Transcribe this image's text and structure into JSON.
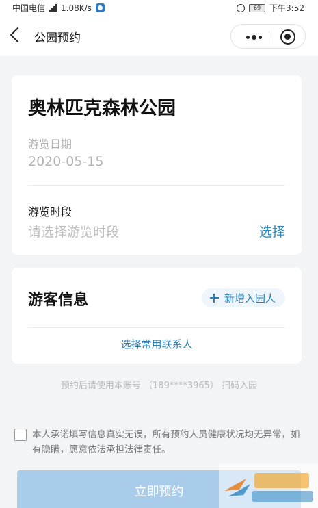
{
  "status_bar": {
    "carrier": "中国电信",
    "network": "4G",
    "speed": "1.08K/s",
    "battery": "69",
    "time": "下午3:52"
  },
  "nav": {
    "title": "公园预约"
  },
  "park": {
    "name": "奥林匹克森林公园",
    "date_label": "游览日期",
    "date_value": "2020-05-15",
    "slot_label": "游览时段",
    "slot_placeholder": "请选择游览时段",
    "slot_action": "选择"
  },
  "visitor": {
    "title": "游客信息",
    "add_label": "新增入园人",
    "common_contacts": "选择常用联系人"
  },
  "scan_hint": "预约后请使用本账号 （189****3965） 扫码入园",
  "agreement": {
    "checked": false,
    "text": "本人承诺填写信息真实无误，所有预约人员健康状况均无异常，如有隐瞒，愿意依法承担法律责任。"
  },
  "submit_label": "立即预约",
  "colors": {
    "accent": "#2b8bc6",
    "button_disabled": "#a9ccea",
    "background": "#f3f4f6"
  }
}
